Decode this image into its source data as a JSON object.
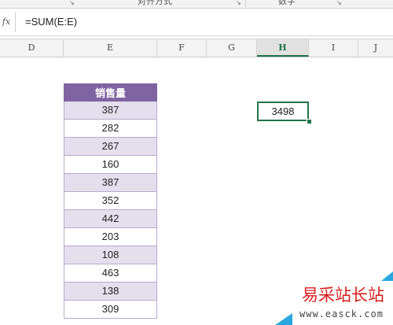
{
  "ribbon": {
    "groups": [
      "对齐方式",
      "数字"
    ]
  },
  "formula_bar": {
    "fx_label": "fx",
    "formula": "=SUM(E:E)"
  },
  "columns": [
    "D",
    "E",
    "F",
    "G",
    "H",
    "I",
    "J"
  ],
  "active_column": "H",
  "table": {
    "header": "销售量",
    "values": [
      "387",
      "282",
      "267",
      "160",
      "387",
      "352",
      "442",
      "203",
      "108",
      "463",
      "138",
      "309"
    ]
  },
  "selected_cell": {
    "value": "3498"
  },
  "watermark": {
    "text": "易采站长站",
    "url": "www.easck.com"
  },
  "colors": {
    "header_purple": "#8064a2",
    "band_purple": "#e4dfec",
    "selection_green": "#217346"
  }
}
